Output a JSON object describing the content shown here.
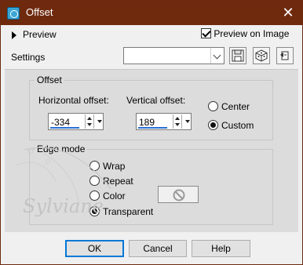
{
  "window": {
    "title": "Offset",
    "close_glyph": "✕"
  },
  "top": {
    "preview_label": "Preview",
    "preview_on_image_label": "Preview on Image",
    "preview_on_image_checked": true
  },
  "settings": {
    "label": "Settings",
    "value": ""
  },
  "offset": {
    "title": "Offset",
    "horizontal_label": "Horizontal offset:",
    "horizontal_value": "-334",
    "vertical_label": "Vertical offset:",
    "vertical_value": "189",
    "center_label": "Center",
    "custom_label": "Custom",
    "selected": "custom"
  },
  "edge_mode": {
    "title": "Edge mode",
    "options": [
      "Wrap",
      "Repeat",
      "Color",
      "Transparent"
    ],
    "selected": "Transparent"
  },
  "watermark_text": "Sylviane",
  "buttons": {
    "ok": "OK",
    "cancel": "Cancel",
    "help": "Help"
  },
  "colors": {
    "titlebar": "#6f2a0e",
    "accent": "#0078d7"
  },
  "icons": [
    "app-icon",
    "close-icon",
    "expand-arrow-icon",
    "save-preset-icon",
    "random-icon",
    "reset-icon",
    "no-color-icon"
  ]
}
